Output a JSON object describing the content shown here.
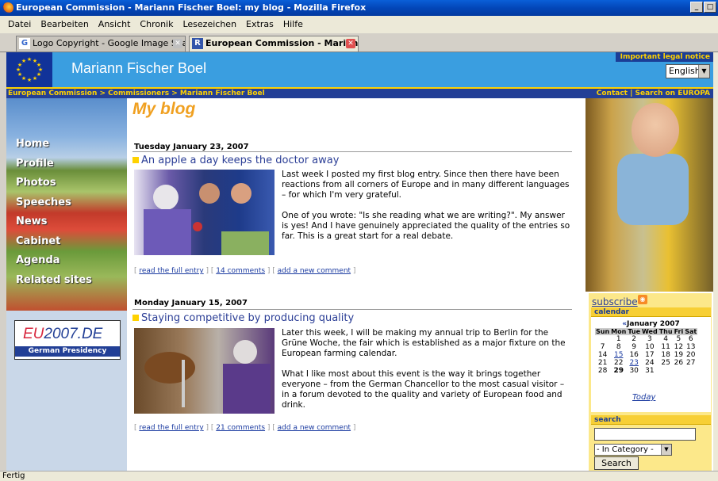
{
  "window": {
    "title": "European Commission - Mariann Fischer Boel: my blog - Mozilla Firefox",
    "controls": [
      "_",
      "□"
    ]
  },
  "menu": [
    "Datei",
    "Bearbeiten",
    "Ansicht",
    "Chronik",
    "Lesezeichen",
    "Extras",
    "Hilfe"
  ],
  "tabs": [
    {
      "label": "Logo Copyright - Google Image Search",
      "icon": "G"
    },
    {
      "label": "European Commission - Mariann ...",
      "icon": "R"
    }
  ],
  "header": {
    "title": "Mariann Fischer Boel",
    "legal": "Important legal notice",
    "language": "English"
  },
  "breadcrumb": {
    "path": "European Commission > Commissioners > Mariann Fischer Boel",
    "right": "Contact | Search on EUROPA"
  },
  "nav": [
    "Home",
    "Profile",
    "Photos",
    "Speeches",
    "News",
    "Cabinet",
    "Agenda",
    "Related sites"
  ],
  "presidency": {
    "logo": "2007.DE",
    "logo_prefix": "EU",
    "caption": "German Presidency"
  },
  "blog_title": "My blog",
  "entries": [
    {
      "date": "Tuesday January 23, 2007",
      "title": "An apple a day keeps the doctor away",
      "p1": "Last week I posted my first blog entry. Since then there have been reactions from all corners of Europe and in many different languages – for which I'm very grateful.",
      "p2": "One of you wrote: \"Is she reading what we are writing?\". My answer is yes! And I have genuinely appreciated the quality of the entries so far. This is a great start for a real debate.",
      "read": "read the full entry",
      "comments": "14 comments",
      "add": "add a new comment"
    },
    {
      "date": "Monday January 15, 2007",
      "title": "Staying competitive by producing quality",
      "p1": "Later this week, I will be making my annual trip to Berlin for the Grüne Woche, the fair which is established as a major fixture on the European farming calendar.",
      "p2": "What I like most about this event is the way it brings together everyone – from the German Chancellor to the most casual visitor – in a forum devoted to the quality and variety of European food and drink.",
      "read": "read the full entry",
      "comments": "21 comments",
      "add": "add a new comment"
    }
  ],
  "sidebar": {
    "subscribe": "subscribe",
    "calendar_header": "calendar",
    "month": "January 2007",
    "prev": "«",
    "weekdays": [
      "Sun",
      "Mon",
      "Tue",
      "Wed",
      "Thu",
      "Fri",
      "Sat"
    ],
    "weeks": [
      [
        "",
        "1",
        "2",
        "3",
        "4",
        "5",
        "6"
      ],
      [
        "7",
        "8",
        "9",
        "10",
        "11",
        "12",
        "13"
      ],
      [
        "14",
        "15",
        "16",
        "17",
        "18",
        "19",
        "20"
      ],
      [
        "21",
        "22",
        "23",
        "24",
        "25",
        "26",
        "27"
      ],
      [
        "28",
        "29",
        "30",
        "31",
        "",
        "",
        ""
      ]
    ],
    "linked_days": [
      "15",
      "23"
    ],
    "bold_day": "29",
    "today": "Today",
    "search_header": "search",
    "category": "- In Category -",
    "search_button": "Search"
  },
  "status": "Fertig"
}
